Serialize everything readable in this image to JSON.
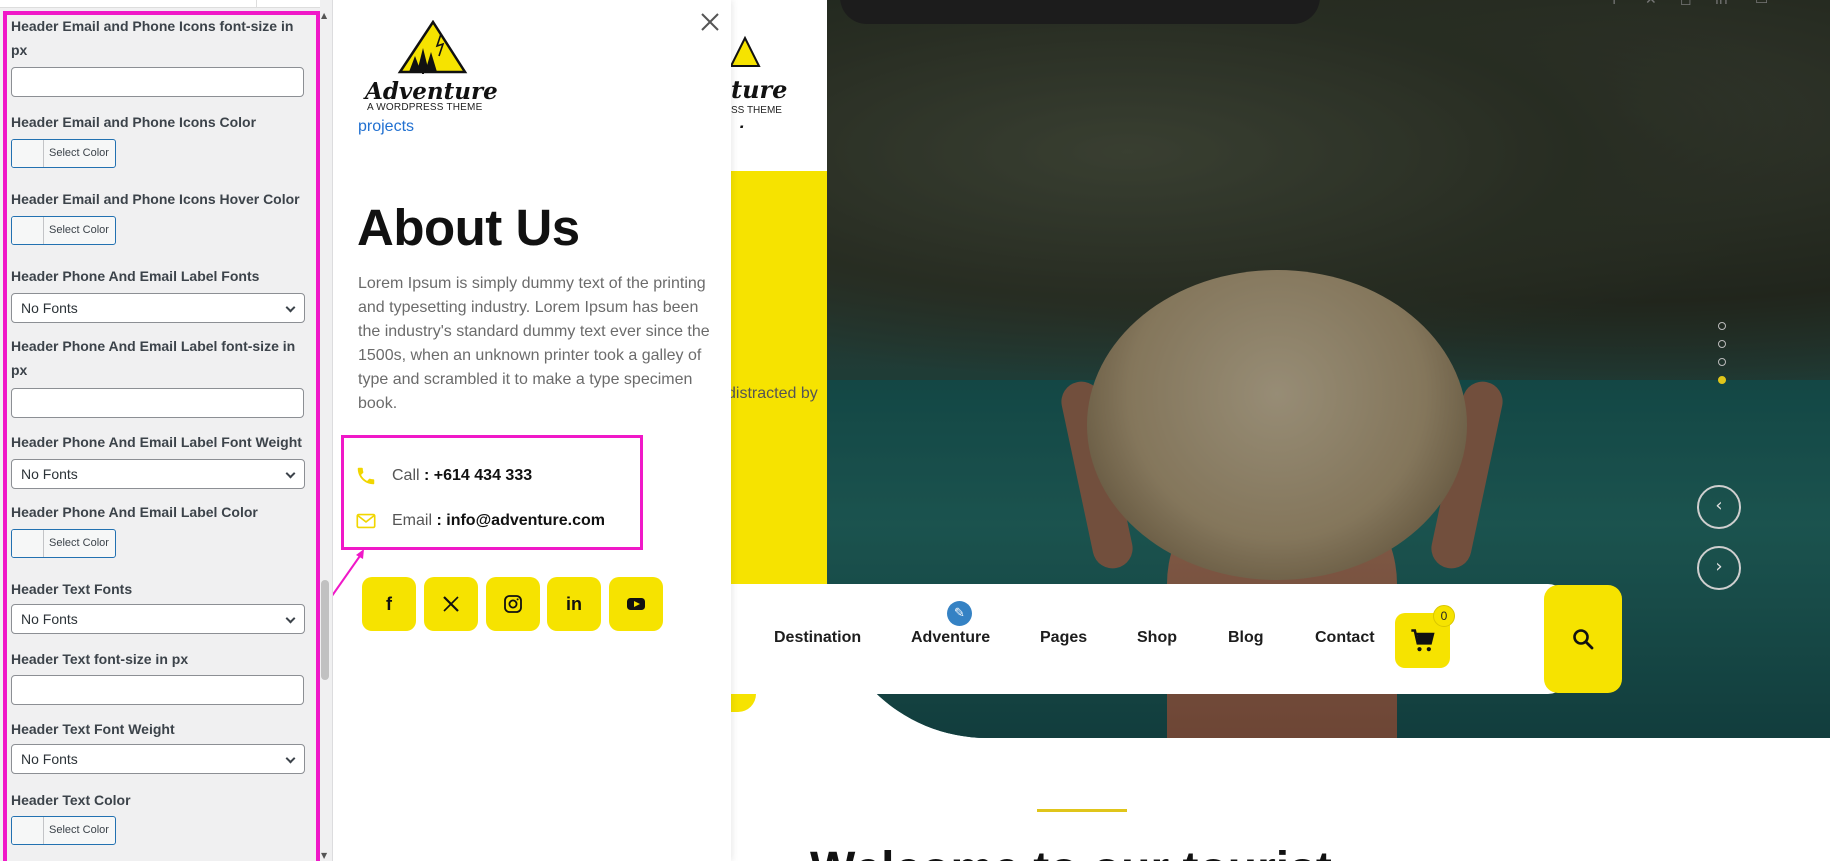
{
  "customizer": {
    "controls": [
      {
        "type": "label",
        "text": "Header Email and Phone Icons font-size in px"
      },
      {
        "type": "input",
        "value": ""
      },
      {
        "type": "label",
        "text": "Header Email and Phone Icons Color"
      },
      {
        "type": "color",
        "button": "Select Color"
      },
      {
        "type": "label",
        "text": "Header Email and Phone Icons Hover Color"
      },
      {
        "type": "color",
        "button": "Select Color"
      },
      {
        "type": "label",
        "text": "Header Phone And Email Label Fonts"
      },
      {
        "type": "select",
        "value": "No Fonts"
      },
      {
        "type": "label",
        "text": "Header Phone And Email Label font-size in px"
      },
      {
        "type": "input",
        "value": ""
      },
      {
        "type": "label",
        "text": "Header Phone And Email Label Font Weight"
      },
      {
        "type": "select",
        "value": "No Fonts"
      },
      {
        "type": "label",
        "text": "Header Phone And Email Label Color"
      },
      {
        "type": "color",
        "button": "Select Color"
      },
      {
        "type": "label",
        "text": "Header Text Fonts"
      },
      {
        "type": "select",
        "value": "No Fonts"
      },
      {
        "type": "label",
        "text": "Header Text font-size in px"
      },
      {
        "type": "input",
        "value": ""
      },
      {
        "type": "label",
        "text": "Header Text Font Weight"
      },
      {
        "type": "select",
        "value": "No Fonts"
      },
      {
        "type": "label",
        "text": "Header Text Color"
      },
      {
        "type": "color",
        "button": "Select Color"
      }
    ]
  },
  "offcanvas": {
    "logo_name": "Adventure",
    "logo_tagline": "A WORDPRESS THEME",
    "projects_link": "projects",
    "about_title": "About Us",
    "about_text": "Lorem Ipsum is simply dummy text of the printing and typesetting industry. Lorem Ipsum has been the industry's standard dummy text ever since the 1500s, when an unknown printer took a galley of type and scrambled it to make a type specimen book.",
    "call_label": "Call",
    "call_value": ": +614 434 333",
    "email_label": "Email",
    "email_value": ": info@adventure.com",
    "social": [
      "facebook-icon",
      "x-icon",
      "instagram-icon",
      "linkedin-icon",
      "youtube-icon"
    ]
  },
  "site": {
    "peek_text": "distracted by",
    "nav": [
      "Destination",
      "Adventure",
      "Pages",
      "Shop",
      "Blog",
      "Contact"
    ],
    "cart_count": "0",
    "welcome": "Welcome to our tourist"
  },
  "colors": {
    "accent_yellow": "#f6e300",
    "highlight_magenta": "#f018c8",
    "link_blue": "#2271d1"
  }
}
